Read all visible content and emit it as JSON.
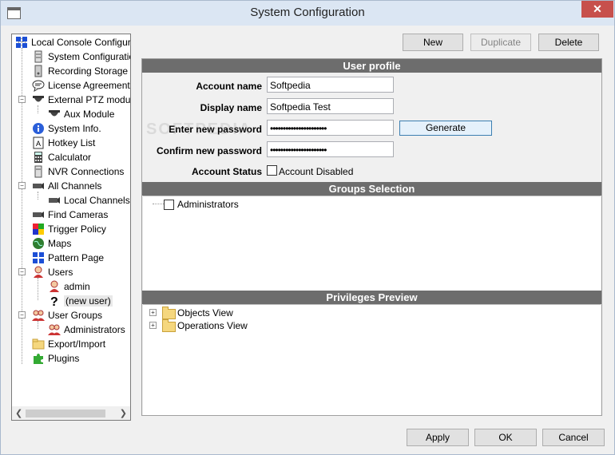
{
  "window": {
    "title": "System Configuration",
    "close_glyph": "✕"
  },
  "tree": {
    "items": [
      {
        "label": "Local Console Configurati",
        "icon": "grid-icon"
      },
      {
        "label": "System Configuration",
        "icon": "server-icon"
      },
      {
        "label": "Recording Storage Se",
        "icon": "storage-icon"
      },
      {
        "label": "License Agreement",
        "icon": "speech-bubble-icon"
      },
      {
        "label": "External PTZ module",
        "icon": "ptz-dome-icon"
      },
      {
        "label": "Aux Module",
        "icon": "ptz-camera-icon"
      },
      {
        "label": "System Info.",
        "icon": "info-icon"
      },
      {
        "label": "Hotkey List",
        "icon": "keyboard-key-icon"
      },
      {
        "label": "Calculator",
        "icon": "calculator-icon"
      },
      {
        "label": "NVR Connections",
        "icon": "nvr-icon"
      },
      {
        "label": "All Channels",
        "icon": "camera-icon"
      },
      {
        "label": "Local Channels",
        "icon": "camera-icon"
      },
      {
        "label": "Find Cameras",
        "icon": "camera-search-icon"
      },
      {
        "label": "Trigger Policy",
        "icon": "trigger-icon"
      },
      {
        "label": "Maps",
        "icon": "globe-icon"
      },
      {
        "label": "Pattern Page",
        "icon": "pattern-icon"
      },
      {
        "label": "Users",
        "icon": "user-icon"
      },
      {
        "label": "admin",
        "icon": "user-icon"
      },
      {
        "label": "(new user)",
        "icon": "question-icon"
      },
      {
        "label": "User Groups",
        "icon": "user-group-icon"
      },
      {
        "label": "Administrators",
        "icon": "user-group-icon"
      },
      {
        "label": "Export/Import",
        "icon": "folder-export-icon"
      },
      {
        "label": "Plugins",
        "icon": "puzzle-icon"
      }
    ]
  },
  "toolbar": {
    "new_label": "New",
    "duplicate_label": "Duplicate",
    "delete_label": "Delete"
  },
  "profile": {
    "header": "User profile",
    "account_name_label": "Account name",
    "account_name_value": "Softpedia",
    "display_name_label": "Display name",
    "display_name_value": "Softpedia Test",
    "new_password_label": "Enter new password",
    "new_password_value": "••••••••••••••••••••••",
    "confirm_password_label": "Confirm new password",
    "confirm_password_value": "••••••••••••••••••••••",
    "generate_label": "Generate",
    "status_label": "Account Status",
    "disabled_label": "Account Disabled"
  },
  "groups": {
    "header": "Groups Selection",
    "items": [
      "Administrators"
    ]
  },
  "privileges": {
    "header": "Privileges Preview",
    "items": [
      "Objects View",
      "Operations View"
    ]
  },
  "footer": {
    "apply_label": "Apply",
    "ok_label": "OK",
    "cancel_label": "Cancel"
  },
  "watermark": "SOFTPEDIA"
}
